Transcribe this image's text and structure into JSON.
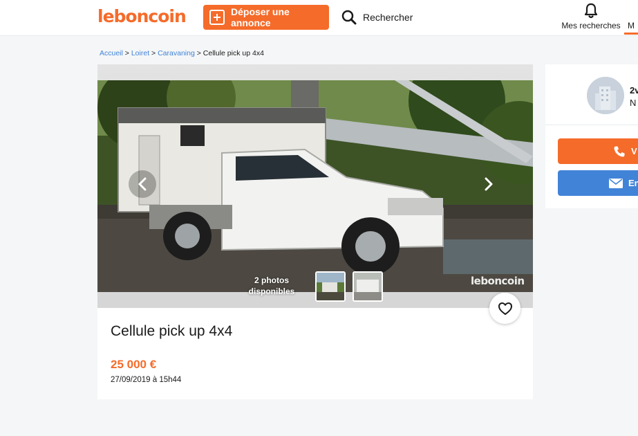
{
  "header": {
    "logo": "leboncoin",
    "post_label": "Déposer une annonce",
    "search_label": "Rechercher",
    "my_searches_label": "Mes recherches",
    "next_item_label": "M"
  },
  "breadcrumb": {
    "items": [
      "Accueil",
      "Loiret",
      "Caravaning"
    ],
    "separator": ">",
    "current": "Cellule pick up 4x4"
  },
  "listing": {
    "photo_count_label": "2 photos disponibles",
    "watermark": "leboncoin",
    "title": "Cellule pick up 4x4",
    "price": "25 000 €",
    "date": "27/09/2019 à 15h44"
  },
  "seller": {
    "name": "2v",
    "subtitle": "N",
    "call_label": "V",
    "message_label": "En"
  },
  "colors": {
    "brand": "#f56b2a",
    "link": "#4183d7",
    "message_button": "#4183d7"
  }
}
